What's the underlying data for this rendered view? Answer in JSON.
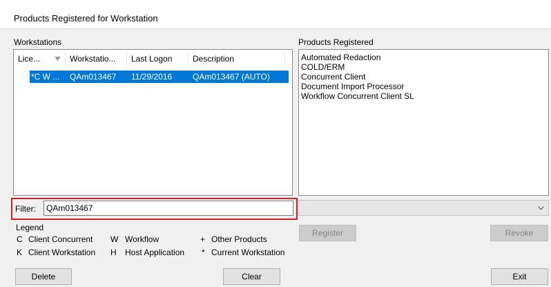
{
  "window": {
    "title": "Products Registered for Workstation"
  },
  "workstations": {
    "label": "Workstations",
    "columns": [
      "Lice...",
      "Workstatio...",
      "Last Logon",
      "Description"
    ],
    "rows": [
      {
        "license": "*C W ...",
        "workstation": "QAm013467",
        "last_logon": "11/29/2016",
        "description": "QAm013467 (AUTO)",
        "selected": true
      }
    ]
  },
  "products": {
    "label": "Products Registered",
    "items": [
      "Automated Redaction",
      "COLD/ERM",
      "Concurrent Client",
      "Document Import Processor",
      "Workflow Concurrent Client SL"
    ]
  },
  "filter": {
    "label": "Filter:",
    "value": "QAm013467"
  },
  "legend": {
    "title": "Legend",
    "items": [
      {
        "key": "C",
        "text": "Client Concurrent"
      },
      {
        "key": "W",
        "text": "Workflow"
      },
      {
        "key": "+",
        "text": "Other Products"
      },
      {
        "key": "K",
        "text": "Client Workstation"
      },
      {
        "key": "H",
        "text": "Host Application"
      },
      {
        "key": "*",
        "text": "Current Workstation"
      }
    ]
  },
  "buttons": {
    "register": "Register",
    "revoke": "Revoke",
    "delete": "Delete",
    "clear": "Clear",
    "exit": "Exit"
  },
  "colors": {
    "selection": "#0078d7",
    "highlight_outline": "#d21f2b"
  }
}
